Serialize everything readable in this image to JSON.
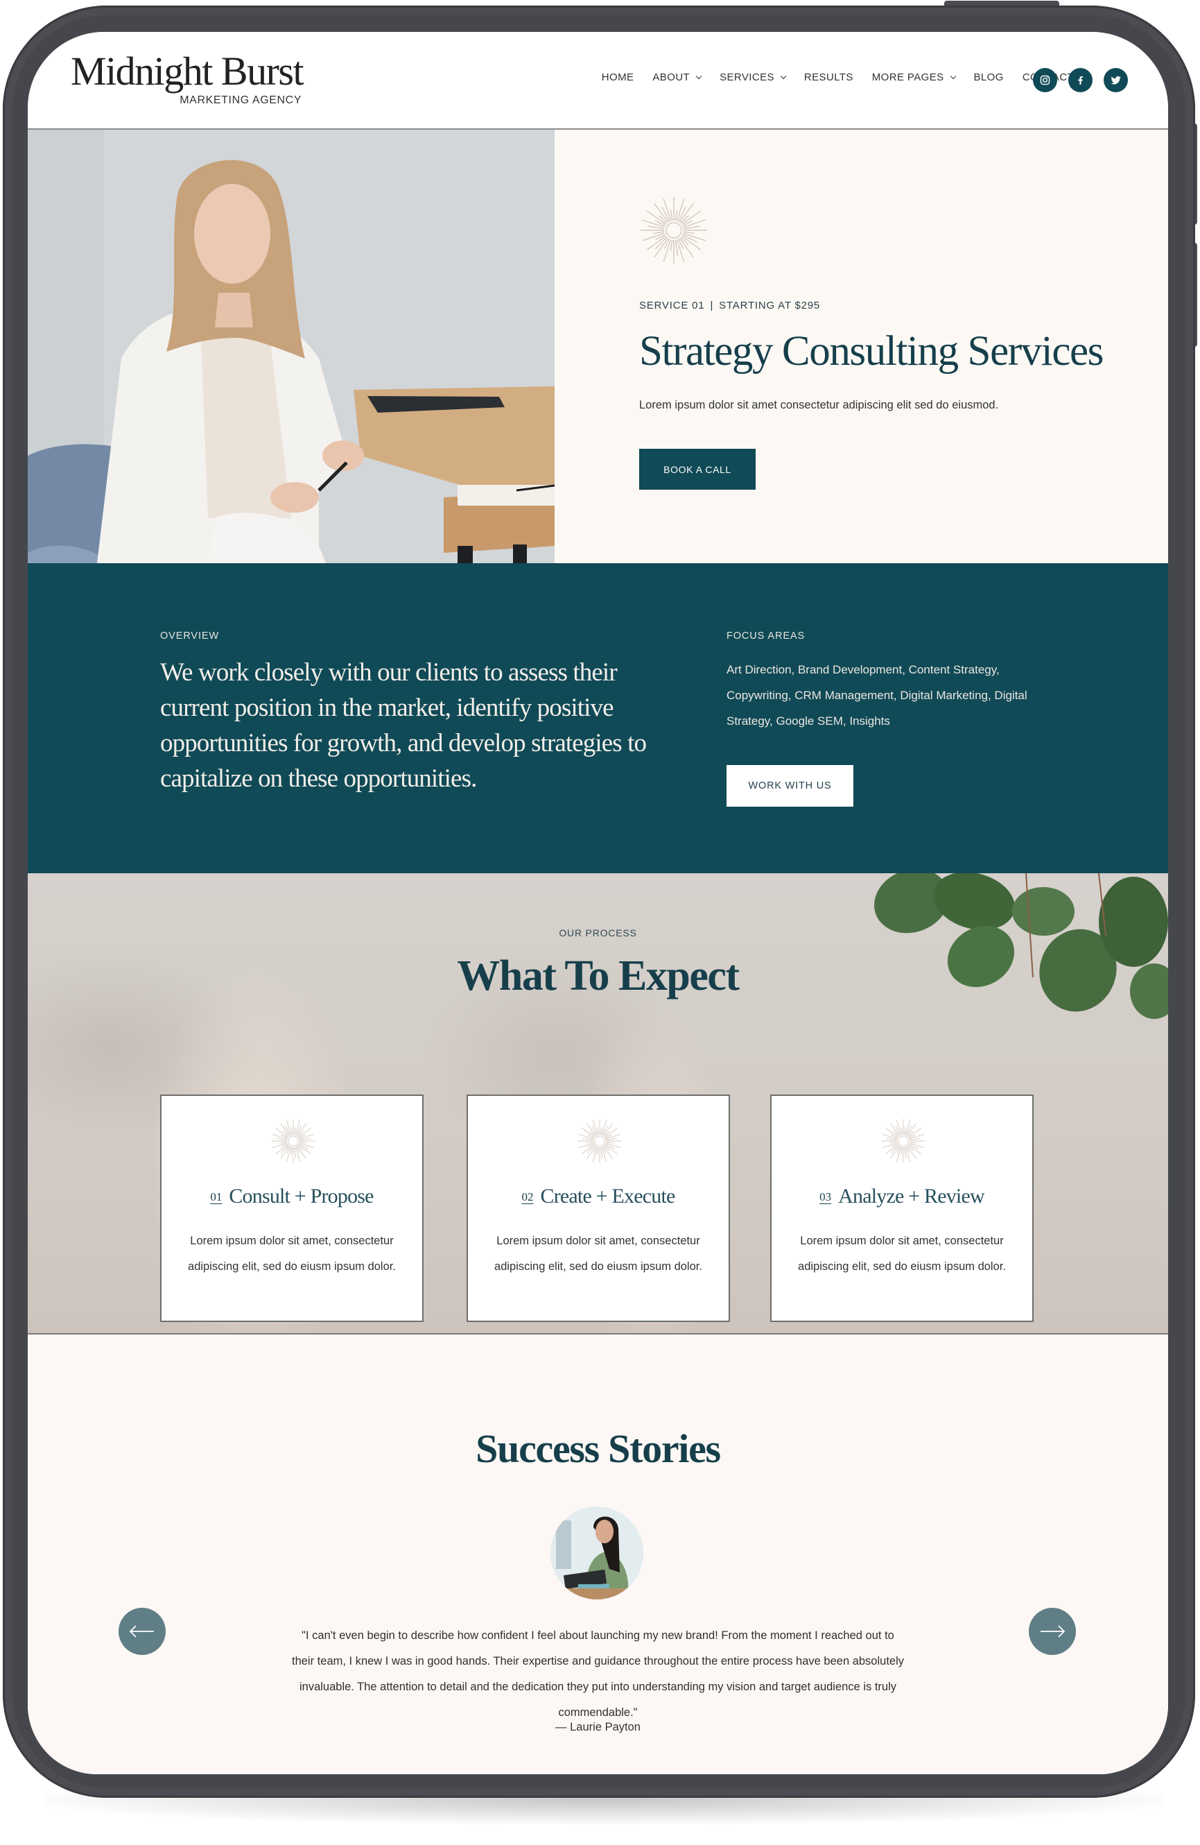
{
  "brand": {
    "name": "Midnight Burst",
    "tagline": "MARKETING AGENCY"
  },
  "nav": {
    "items": [
      {
        "label": "HOME",
        "has_dropdown": false
      },
      {
        "label": "ABOUT",
        "has_dropdown": true
      },
      {
        "label": "SERVICES",
        "has_dropdown": true
      },
      {
        "label": "RESULTS",
        "has_dropdown": false
      },
      {
        "label": "MORE PAGES",
        "has_dropdown": true
      },
      {
        "label": "BLOG",
        "has_dropdown": false
      },
      {
        "label": "CONTACT",
        "has_dropdown": false
      }
    ],
    "socials": [
      "instagram-icon",
      "facebook-icon",
      "twitter-icon"
    ]
  },
  "hero": {
    "eyebrow_service": "SERVICE 01",
    "eyebrow_separator": "|",
    "eyebrow_price": "STARTING AT $295",
    "title": "Strategy Consulting Services",
    "description": "Lorem ipsum dolor sit amet consectetur adipiscing elit sed do eiusmod.",
    "cta_label": "BOOK A CALL"
  },
  "overview": {
    "label": "OVERVIEW",
    "text": "We work closely with our clients to assess their current position in the market, identify positive opportunities for growth, and develop strategies to capitalize on these opportunities.",
    "focus_label": "FOCUS AREAS",
    "focus_text": "Art Direction, Brand Development, Content Strategy, Copywriting, CRM Management, Digital Marketing, Digital Strategy, Google SEM, Insights",
    "cta_label": "WORK WITH US"
  },
  "process": {
    "label": "OUR PROCESS",
    "title": "What To Expect",
    "steps": [
      {
        "number": "01",
        "title": "Consult + Propose",
        "text": "Lorem ipsum dolor sit amet, consectetur adipiscing elit, sed do eiusm ipsum dolor."
      },
      {
        "number": "02",
        "title": "Create + Execute",
        "text": "Lorem ipsum dolor sit amet, consectetur adipiscing elit, sed do eiusm ipsum dolor."
      },
      {
        "number": "03",
        "title": "Analyze + Review",
        "text": "Lorem ipsum dolor sit amet, consectetur adipiscing elit, sed do eiusm ipsum dolor."
      }
    ]
  },
  "testimonials": {
    "title": "Success Stories",
    "quote": "\"I can't even begin to describe how confident I feel about launching my new brand! From the moment I reached out to their team, I knew I was in good hands. Their expertise and guidance throughout the entire process have been absolutely invaluable. The attention to detail and the dedication they put into understanding my vision and target audience is truly commendable.\"",
    "author": "— Laurie Payton",
    "prev_icon": "arrow-left-icon",
    "next_icon": "arrow-right-icon"
  },
  "colors": {
    "brand_teal": "#104a56",
    "heading_teal": "#163f4b",
    "arrow_button": "#5f7e85",
    "cream_background": "#fcf9f5",
    "starburst": "#d4c8bd",
    "device_frame": "#45474c"
  }
}
